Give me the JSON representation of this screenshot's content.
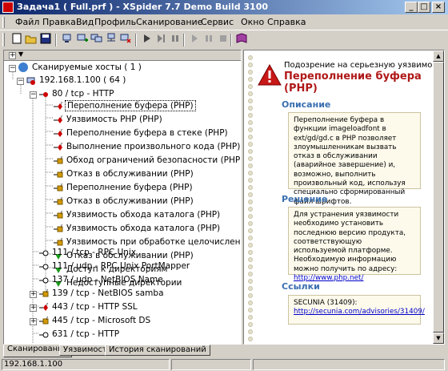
{
  "window": {
    "title": "Задача1 ( Full.prf ) - XSpider 7.7 Demo Build 3100"
  },
  "menu": [
    "Файл",
    "Правка",
    "Вид",
    "Профиль",
    "Сканирование",
    "Сервис",
    "Окно",
    "Справка"
  ],
  "tree": {
    "root": "Сканируемые хосты ( 1 )",
    "host": "192.168.1.100 ( 64 )",
    "port80": "80 / tcp - HTTP",
    "vulns": [
      {
        "label": "Переполнение буфера (PHP)",
        "icon": "vuln",
        "selected": true
      },
      {
        "label": "Уязвимость PHP (PHP)",
        "icon": "vuln"
      },
      {
        "label": "Переполнение буфера в стеке (PHP)",
        "icon": "vuln"
      },
      {
        "label": "Выполнение произвольного кода (PHP)",
        "icon": "vuln"
      },
      {
        "label": "Обход ограничений безопасности (PHP)",
        "icon": "info"
      },
      {
        "label": "Отказ в обслуживании (PHP)",
        "icon": "info"
      },
      {
        "label": "Переполнение буфера (PHP)",
        "icon": "info"
      },
      {
        "label": "Отказ в обслуживании (PHP)",
        "icon": "info"
      },
      {
        "label": "Уязвимость обхода каталога (PHP)",
        "icon": "info"
      },
      {
        "label": "Уязвимость обхода каталога (PHP)",
        "icon": "info"
      },
      {
        "label": "Уязвимость при обработке целочисленных типов (PHP)",
        "icon": "info"
      },
      {
        "label": "Отказ в обслуживании (PHP)",
        "icon": "ok"
      },
      {
        "label": "Доступ к директориям",
        "icon": "ok"
      },
      {
        "label": "Недоступные директории",
        "icon": "ok"
      }
    ],
    "ports": [
      {
        "label": "111 / tcp - RPC  Unix",
        "icon": "port",
        "expandable": false
      },
      {
        "label": "111 / udp - RPC  Unix PortMapper",
        "icon": "port",
        "expandable": false
      },
      {
        "label": "137 / udp - NetBIOS Name",
        "icon": "port",
        "expandable": false
      },
      {
        "label": "139 / tcp - NetBIOS samba",
        "icon": "info",
        "expandable": true
      },
      {
        "label": "443 / tcp - HTTP SSL",
        "icon": "vuln",
        "expandable": true
      },
      {
        "label": "445 / tcp - Microsoft DS",
        "icon": "info",
        "expandable": true
      },
      {
        "label": "631 / tcp - HTTP",
        "icon": "port",
        "expandable": false
      }
    ]
  },
  "detail": {
    "subtitle": "Подозрение на серьезную уязвимость",
    "title": "Переполнение буфера (PHP)",
    "description_heading": "Описание",
    "description": "Переполнение буфера в функции imageloadfont в ext/gd/gd.c в PHP позволяет злоумышленникам вызвать отказ в обслуживании (аварийное завершение) и, возможно, выполнить произвольный код, используя специально сформированный файл шрифтов.",
    "solution_heading": "Решение",
    "solution": "Для устранения уязвимости необходимо установить последнюю версию продукта, соответствующую используемой платформе. Необходимую информацию можно получить по адресу:",
    "solution_link": "http://www.php.net/",
    "links_heading": "Ссылки",
    "links_label": "SECUNIA (31409):",
    "links_url": "http://secunia.com/advisories/31409/"
  },
  "tabs": [
    "Сканирование",
    "Уязвимости",
    "История сканирований"
  ],
  "status": {
    "host": "192.168.1.100"
  },
  "colors": {
    "accent": "#3a6fb0",
    "danger": "#b01818",
    "link": "#0000c8"
  }
}
